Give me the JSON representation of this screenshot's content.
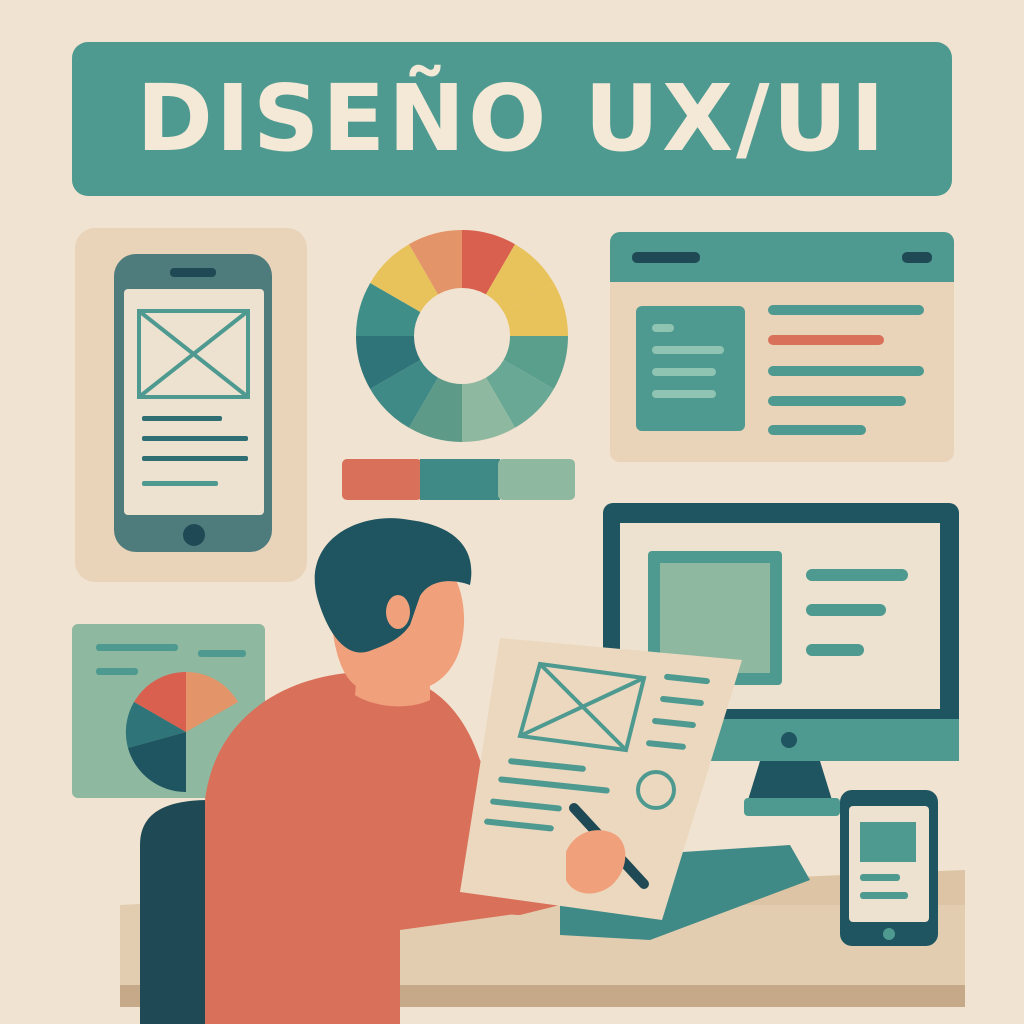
{
  "title": "DISEÑO UX/UI",
  "palette": {
    "background": "#f1e3d1",
    "teal": "#4e9a90",
    "dark_teal": "#1f5560",
    "sage": "#8fb8a0",
    "coral": "#d9705a",
    "orange": "#e39468",
    "yellow": "#e8c25b",
    "cream": "#f4e8d6",
    "sand": "#e9d3b9",
    "skin": "#f0a07b"
  },
  "icons": [
    "phone-wireframe",
    "color-wheel",
    "browser-window",
    "desktop-monitor",
    "pie-chart-card",
    "small-phone",
    "designer-person",
    "pen"
  ]
}
